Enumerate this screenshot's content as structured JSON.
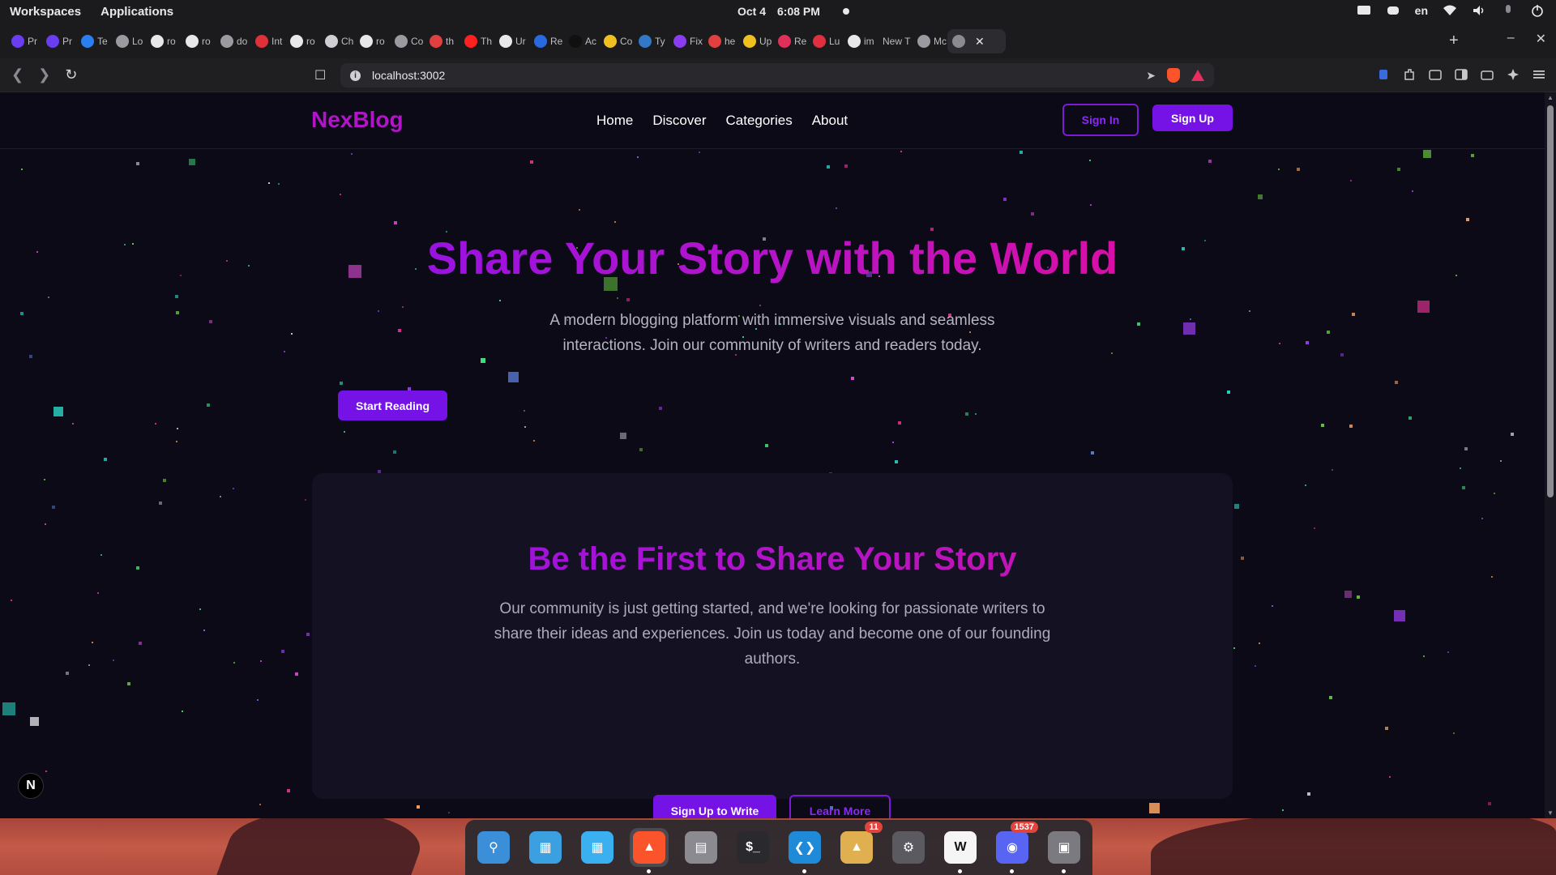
{
  "system_bar": {
    "workspaces": "Workspaces",
    "applications": "Applications",
    "date": "Oct 4",
    "time": "6:08 PM",
    "language": "en"
  },
  "tabs": [
    {
      "label": "Pr",
      "color": "#6a3df0"
    },
    {
      "label": "Pr",
      "color": "#6a3df0"
    },
    {
      "label": "Te",
      "color": "#2a7ff0"
    },
    {
      "label": "Lo",
      "color": "#9a9aa0"
    },
    {
      "label": "ro",
      "color": "#e8e8ea"
    },
    {
      "label": "ro",
      "color": "#e8e8ea"
    },
    {
      "label": "do",
      "color": "#9a9aa0"
    },
    {
      "label": "Int",
      "color": "#e0303a"
    },
    {
      "label": "ro",
      "color": "#e8e8ea"
    },
    {
      "label": "Ch",
      "color": "#cfcfd4"
    },
    {
      "label": "ro",
      "color": "#e8e8ea"
    },
    {
      "label": "Co",
      "color": "#9a9aa0"
    },
    {
      "label": "th",
      "color": "#e04040"
    },
    {
      "label": "Th",
      "color": "#ff2020"
    },
    {
      "label": "Ur",
      "color": "#e8e8ea"
    },
    {
      "label": "Re",
      "color": "#2a6ae0"
    },
    {
      "label": "Ac",
      "color": "#101010"
    },
    {
      "label": "Co",
      "color": "#f0c020"
    },
    {
      "label": "Ty",
      "color": "#3178c6"
    },
    {
      "label": "Fix",
      "color": "#8a3df0"
    },
    {
      "label": "he",
      "color": "#e04040"
    },
    {
      "label": "Up",
      "color": "#f0c020"
    },
    {
      "label": "Re",
      "color": "#e0305a"
    },
    {
      "label": "Lu",
      "color": "#e03040"
    },
    {
      "label": "im",
      "color": "#e8e8ea"
    },
    {
      "label": "New T",
      "color": ""
    },
    {
      "label": "Mc",
      "color": "#9a9aa0"
    }
  ],
  "address_bar": {
    "url": "localhost:3002"
  },
  "site": {
    "logo": "NexBlog",
    "nav": [
      "Home",
      "Discover",
      "Categories",
      "About"
    ],
    "sign_in": "Sign In",
    "sign_up": "Sign Up",
    "hero_title": "Share Your Story with the World",
    "hero_subtitle": "A modern blogging platform with immersive visuals and seamless interactions. Join our community of writers and readers today.",
    "start_reading": "Start Reading",
    "card_title": "Be the First to Share Your Story",
    "card_text": "Our community is just getting started, and we're looking for passionate writers to share their ideas and experiences. Join us today and become one of our founding authors.",
    "sign_up_to_write": "Sign Up to Write",
    "learn_more": "Learn More",
    "next_badge": "N",
    "colors": {
      "accent": "#7512e6",
      "gradient_start": "#9a12e0",
      "gradient_end": "#d80fa6",
      "background": "#0c0a16"
    }
  },
  "dock": {
    "apps": [
      {
        "name": "search-app-icon",
        "color": "#3a8fd8"
      },
      {
        "name": "files-preview-icon",
        "color": "#3aa0e0"
      },
      {
        "name": "app-grid-icon",
        "color": "#3ab0f0"
      },
      {
        "name": "brave-browser-icon",
        "color": "#fb542b",
        "running": true,
        "selected": true
      },
      {
        "name": "file-manager-icon",
        "color": "#8a8a90"
      },
      {
        "name": "terminal-icon",
        "color": "#2a2a2e"
      },
      {
        "name": "vscode-icon",
        "color": "#1f8ad8",
        "running": true
      },
      {
        "name": "package-installer-icon",
        "color": "#e0b050",
        "badge": "11"
      },
      {
        "name": "settings-icon",
        "color": "#5a5a60"
      },
      {
        "name": "writer-app-icon",
        "color": "#f5f5f5",
        "running": true
      },
      {
        "name": "discord-icon",
        "color": "#5865f2",
        "badge": "1537",
        "running": true
      },
      {
        "name": "disk-utility-icon",
        "color": "#7a7a80",
        "running": true
      }
    ]
  }
}
